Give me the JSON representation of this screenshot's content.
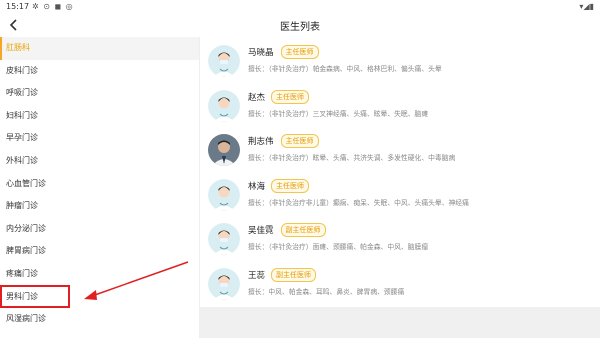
{
  "status": {
    "time": "15:17",
    "left_icons": "✲ ⊙ ◼ ◎",
    "right_icons": "▾◢▮"
  },
  "header": {
    "title": "医生列表"
  },
  "sidebar": {
    "items": [
      {
        "label": "肛肠科",
        "active": true
      },
      {
        "label": "皮科门诊"
      },
      {
        "label": "呼吸门诊"
      },
      {
        "label": "妇科门诊"
      },
      {
        "label": "早孕门诊"
      },
      {
        "label": "外科门诊"
      },
      {
        "label": "心血管门诊"
      },
      {
        "label": "肿瘤门诊"
      },
      {
        "label": "内分泌门诊"
      },
      {
        "label": "脾胃病门诊"
      },
      {
        "label": "疼痛门诊"
      },
      {
        "label": "男科门诊"
      },
      {
        "label": "风湿病门诊"
      }
    ]
  },
  "doctors": [
    {
      "name": "马晓晶",
      "title": "主任医师",
      "skill": "擅长：（非针灸治疗）帕金森病、中风、格林巴利、偏头痛、头晕",
      "avatar": "female"
    },
    {
      "name": "赵杰",
      "title": "主任医师",
      "skill": "擅长：（非针灸治疗）三叉神经痛、头痛、眩晕、失眠、脑瘫",
      "avatar": "male-cartoon"
    },
    {
      "name": "荆志伟",
      "title": "主任医师",
      "skill": "擅长：（非针灸治疗）眩晕、头痛、共济失调、多发性硬化、中毒脑病",
      "avatar": "photo"
    },
    {
      "name": "林海",
      "title": "主任医师",
      "skill": "擅长：（非针灸治疗非儿童）癫痫、痴呆、失眠、中风、头痛头晕、神经痛",
      "avatar": "male-cartoon"
    },
    {
      "name": "吴佳霓",
      "title": "副主任医师",
      "skill": "擅长：（非针灸治疗）面瘫、颈腰痛、帕金森、中风、脑膜瘤",
      "avatar": "female"
    },
    {
      "name": "王蕊",
      "title": "副主任医师",
      "skill": "擅长：中风、帕金森、耳鸣、鼻炎、脾胃病、颈腰痛",
      "avatar": "female"
    }
  ],
  "colors": {
    "accent": "#f5a623",
    "badge_text": "#e59a00",
    "annotation": "#e02020"
  }
}
